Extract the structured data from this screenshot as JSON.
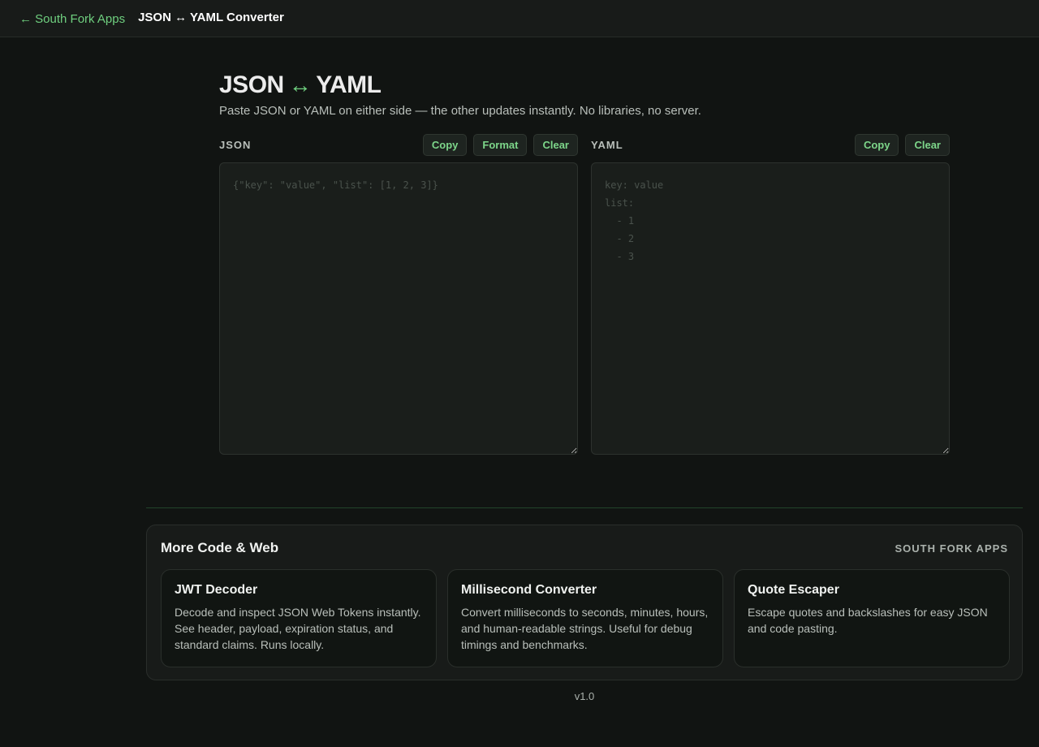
{
  "topbar": {
    "back_label": "← South Fork Apps",
    "title": "JSON ↔ YAML Converter"
  },
  "header": {
    "title_left": "JSON",
    "title_arrow": "↔",
    "title_right": "YAML",
    "subtitle": "Paste JSON or YAML on either side — the other updates instantly. No libraries, no server."
  },
  "json_pane": {
    "label": "JSON",
    "copy_label": "Copy",
    "format_label": "Format",
    "clear_label": "Clear",
    "value": "",
    "placeholder": "{\"key\": \"value\", \"list\": [1, 2, 3]}"
  },
  "yaml_pane": {
    "label": "YAML",
    "copy_label": "Copy",
    "clear_label": "Clear",
    "value": "",
    "placeholder": "key: value\nlist:\n  - 1\n  - 2\n  - 3"
  },
  "related": {
    "title": "More Code & Web",
    "brand": "SOUTH FORK APPS",
    "cards": [
      {
        "title": "JWT Decoder",
        "description": "Decode and inspect JSON Web Tokens instantly. See header, payload, expiration status, and standard claims. Runs locally."
      },
      {
        "title": "Millisecond Converter",
        "description": "Convert milliseconds to seconds, minutes, hours, and human-readable strings. Useful for debug timings and benchmarks."
      },
      {
        "title": "Quote Escaper",
        "description": "Escape quotes and backslashes for easy JSON and code pasting."
      }
    ]
  },
  "footer": {
    "version": "v1.0"
  },
  "colors": {
    "accent": "#6fcf7f",
    "background": "#111412",
    "panel": "#181b19"
  }
}
